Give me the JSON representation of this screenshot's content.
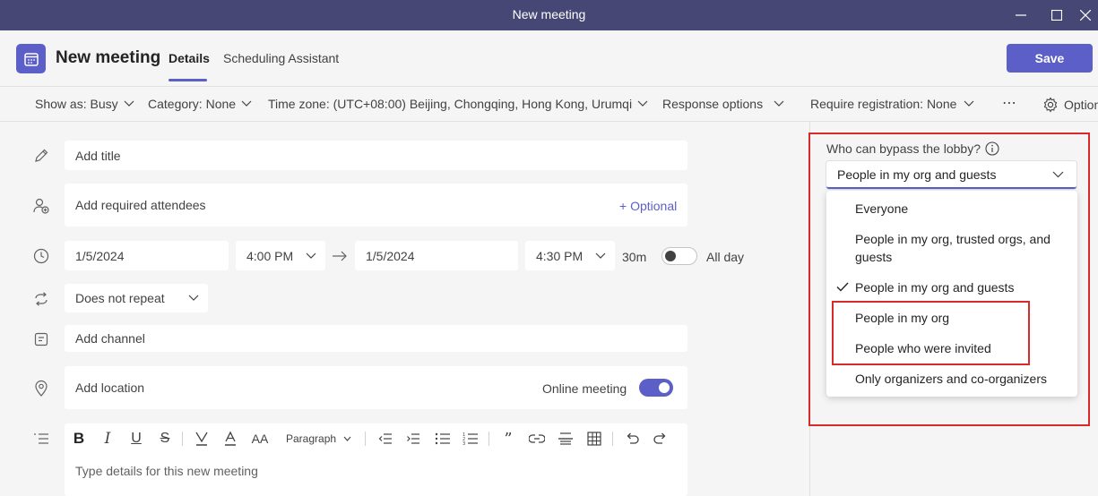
{
  "window": {
    "title": "New meeting"
  },
  "header": {
    "title": "New meeting",
    "tab_details": "Details",
    "tab_scheduling": "Scheduling Assistant",
    "save_label": "Save"
  },
  "toolbar": {
    "show_as": "Show as: Busy",
    "category": "Category: None",
    "timezone": "Time zone: (UTC+08:00) Beijing, Chongqing, Hong Kong, Urumqi",
    "response": "Response options",
    "registration": "Require registration: None",
    "more": "⋯",
    "options": "Options"
  },
  "form": {
    "title_placeholder": "Add title",
    "attendees_placeholder": "Add required attendees",
    "optional_link": "+ Optional",
    "start_date": "1/5/2024",
    "start_time": "4:00 PM",
    "end_date": "1/5/2024",
    "end_time": "4:30 PM",
    "duration": "30m",
    "all_day_label": "All day",
    "repeat": "Does not repeat",
    "channel_placeholder": "Add channel",
    "location_placeholder": "Add location",
    "online_meeting_label": "Online meeting",
    "online_meeting_on": true,
    "paragraph": "Paragraph",
    "details_placeholder": "Type details for this new meeting"
  },
  "lobby": {
    "label": "Who can bypass the lobby?",
    "selected": "People in my org and guests",
    "options": [
      "Everyone",
      "People in my org, trusted orgs, and guests",
      "People in my org and guests",
      "People in my org",
      "People who were invited",
      "Only organizers and co-organizers"
    ],
    "checked_index": 2
  },
  "colors": {
    "titlebar": "#464775",
    "accent": "#5b5fc7",
    "highlight_box": "#d92a2a"
  },
  "icons": [
    "app-calendar-icon",
    "minimize-icon",
    "maximize-icon",
    "close-icon",
    "pencil-icon",
    "person-add-icon",
    "clock-icon",
    "repeat-icon",
    "channel-icon",
    "location-icon",
    "details-list-icon",
    "info-icon",
    "gear-icon",
    "checkmark-icon"
  ]
}
